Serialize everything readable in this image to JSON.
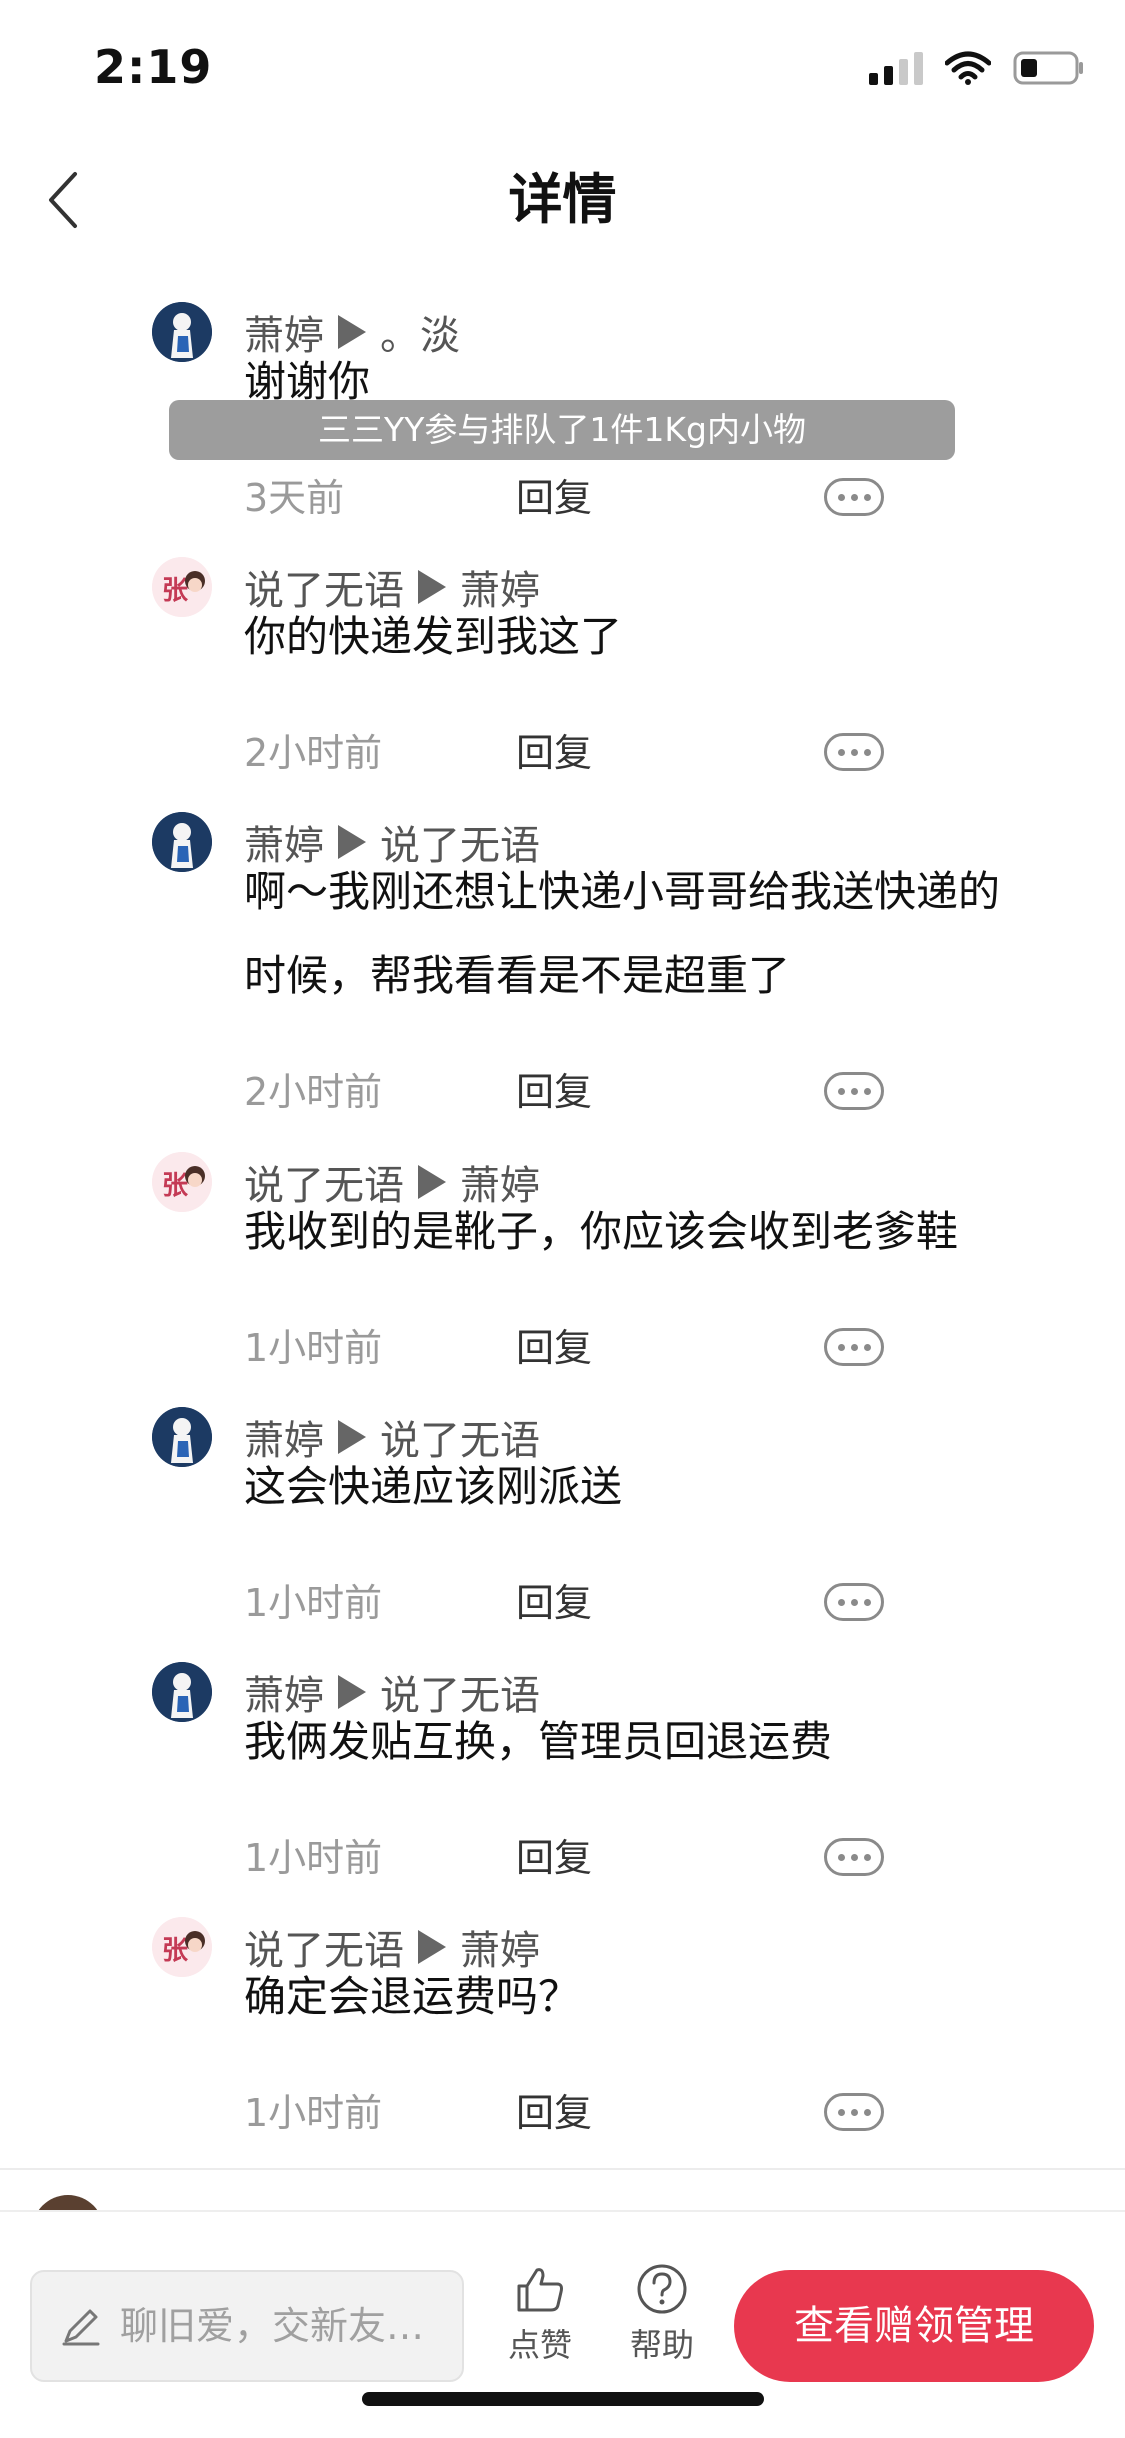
{
  "status_bar": {
    "time": "2:19"
  },
  "nav": {
    "title": "详情"
  },
  "toast": {
    "text": "三三YY参与排队了1件1Kg内小物"
  },
  "comments": [
    {
      "from": "萧婷",
      "to": "。淡",
      "lines": [
        "谢谢你"
      ],
      "time": "3天前",
      "reply": "回复"
    },
    {
      "from": "说了无语",
      "to": "萧婷",
      "lines": [
        "你的快递发到我这了"
      ],
      "time": "2小时前",
      "reply": "回复"
    },
    {
      "from": "萧婷",
      "to": "说了无语",
      "lines": [
        "啊～我刚还想让快递小哥哥给我送快递的",
        "时候，帮我看看是不是超重了"
      ],
      "time": "2小时前",
      "reply": "回复"
    },
    {
      "from": "说了无语",
      "to": "萧婷",
      "lines": [
        "我收到的是靴子，你应该会收到老爹鞋"
      ],
      "time": "1小时前",
      "reply": "回复"
    },
    {
      "from": "萧婷",
      "to": "说了无语",
      "lines": [
        "这会快递应该刚派送"
      ],
      "time": "1小时前",
      "reply": "回复"
    },
    {
      "from": "萧婷",
      "to": "说了无语",
      "lines": [
        "我俩发贴互换，管理员回退运费"
      ],
      "time": "1小时前",
      "reply": "回复"
    },
    {
      "from": "说了无语",
      "to": "萧婷",
      "lines": [
        "确定会退运费吗？"
      ],
      "time": "1小时前",
      "reply": "回复"
    }
  ],
  "bottom_bar": {
    "input_placeholder": "聊旧爱，交新友…",
    "like_label": "点赞",
    "help_label": "帮助",
    "primary_button": "查看赠领管理"
  },
  "colors": {
    "accent": "#e8384f",
    "muted_text": "#9a9a9a"
  }
}
